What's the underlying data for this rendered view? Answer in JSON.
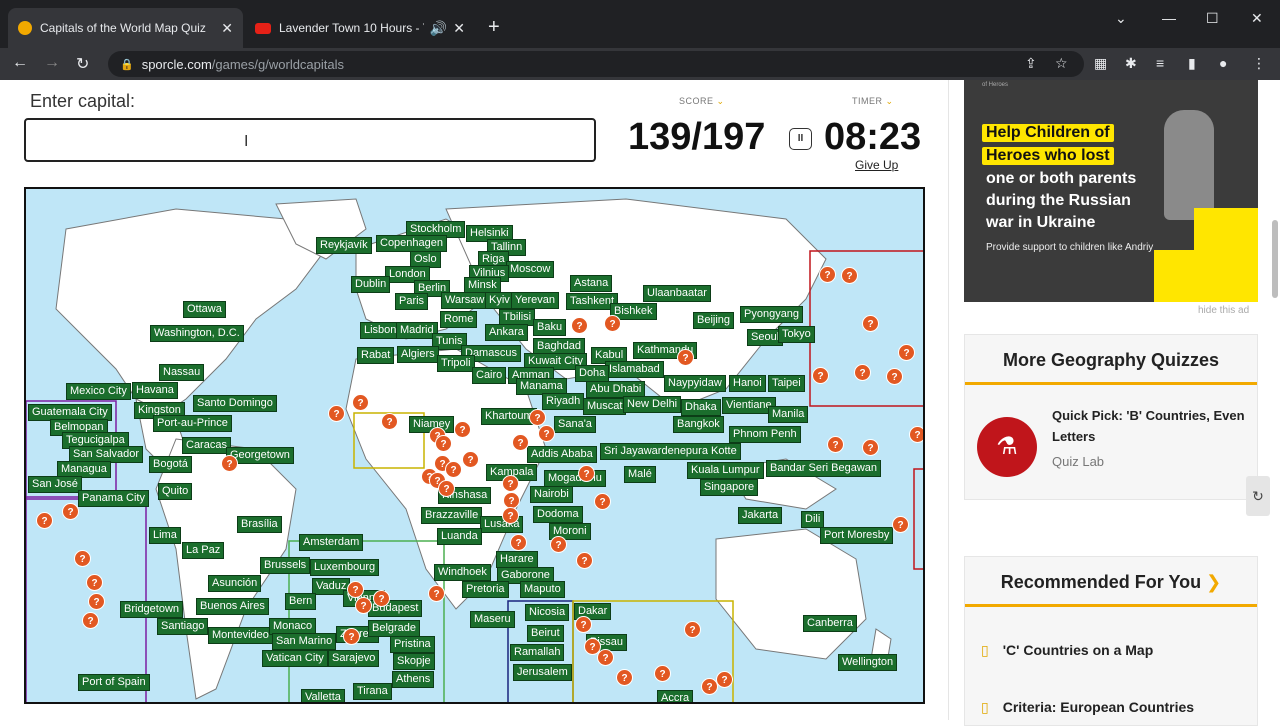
{
  "browser": {
    "tabs": [
      {
        "title": "Capitals of the World Map Quiz",
        "active": true
      },
      {
        "title": "Lavender Town 10 Hours - Yo",
        "active": false
      }
    ],
    "url_host": "sporcle.com",
    "url_path": "/games/g/worldcapitals"
  },
  "quiz": {
    "enter_label": "Enter capital:",
    "input_value": "",
    "score_label": "SCORE",
    "timer_label": "TIMER",
    "score": "139/197",
    "timer": "08:23",
    "give_up": "Give Up"
  },
  "map": {
    "capitals": [
      "Stockholm",
      "Helsinki",
      "Reykjavík",
      "Copenhagen",
      "Tallinn",
      "Oslo",
      "Riga",
      "London",
      "Moscow",
      "Vilnius",
      "Minsk",
      "Dublin",
      "Berlin",
      "Astana",
      "Paris",
      "Warsaw",
      "Kyiv",
      "Yerevan",
      "Tashkent",
      "Ulaanbaatar",
      "Ottawa",
      "Bishkek",
      "Rome",
      "Tbilisi",
      "Beijing",
      "Pyongyang",
      "Washington, D.C.",
      "Lisbon",
      "Madrid",
      "Ankara",
      "Baku",
      "Seoul",
      "Tokyo",
      "Tunis",
      "Baghdad",
      "Kabul",
      "Kathmandu",
      "Rabat",
      "Algiers",
      "Damascus",
      "Tripoli",
      "Kuwait City",
      "Islamabad",
      "Nassau",
      "Cairo",
      "Amman",
      "Doha",
      "Naypyidaw",
      "Hanoi",
      "Taipei",
      "Mexico City",
      "Havana",
      "Manama",
      "Abu Dhabi",
      "Guatemala City",
      "Kingston",
      "Santo Domingo",
      "Riyadh",
      "Muscat",
      "New Delhi",
      "Dhaka",
      "Vientiane",
      "Manila",
      "Belmopan",
      "Port-au-Prince",
      "Niamey",
      "Khartoum",
      "Sana'a",
      "Tegucigalpa",
      "Caracas",
      "Phnom Penh",
      "San Salvador",
      "Georgetown",
      "Addis Ababa",
      "Sri Jayawardenepura Kotte",
      "Bangkok",
      "Managua",
      "Bogotá",
      "Kampala",
      "Mogadishu",
      "Malé",
      "Kuala Lumpur",
      "Bandar Seri Begawan",
      "San José",
      "Quito",
      "Kinshasa",
      "Nairobi",
      "Singapore",
      "Panama City",
      "Brazzaville",
      "Dodoma",
      "Jakarta",
      "Dili",
      "Lusaka",
      "Moroni",
      "Port Moresby",
      "Brasília",
      "Lima",
      "Luanda",
      "La Paz",
      "Amsterdam",
      "Harare",
      "Brussels",
      "Luxembourg",
      "Gaborone",
      "Windhoek",
      "Asunción",
      "Vaduz",
      "Pretoria",
      "Maputo",
      "Vienna",
      "Bern",
      "Budapest",
      "Nicosia",
      "Dakar",
      "Bridgetown",
      "Buenos Aires",
      "Maseru",
      "Canberra",
      "Santiago",
      "Montevideo",
      "Monaco",
      "Zagreb",
      "Belgrade",
      "Beirut",
      "Bissau",
      "San Marino",
      "Pristina",
      "Ramallah",
      "Vatican City",
      "Sarajevo",
      "Skopje",
      "Jerusalem",
      "Wellington",
      "Port of Spain",
      "Athens",
      "Valletta",
      "Tirana",
      "Accra"
    ]
  },
  "sidebar": {
    "ad": {
      "line1": "Help Children of",
      "line2": "Heroes who lost",
      "line3": "one or both parents",
      "line4": "during the Russian",
      "line5": "war in Ukraine",
      "small": "Provide support to children like Andriy",
      "brand": "of Heroes"
    },
    "hide_ad": "hide this ad",
    "more_geo_title": "More Geography Quizzes",
    "quiz_pick_title": "Quick Pick: 'B' Countries, Even Letters",
    "quiz_pick_author": "Quiz Lab",
    "recommended_title": "Recommended For You",
    "recommended": [
      "'C' Countries on a Map",
      "Criteria: European Countries"
    ]
  },
  "colors": {
    "accent": "#f2a900",
    "label_green": "#1b6e2d",
    "pin_orange": "#e25822",
    "ocean": "#bfe6f7"
  }
}
